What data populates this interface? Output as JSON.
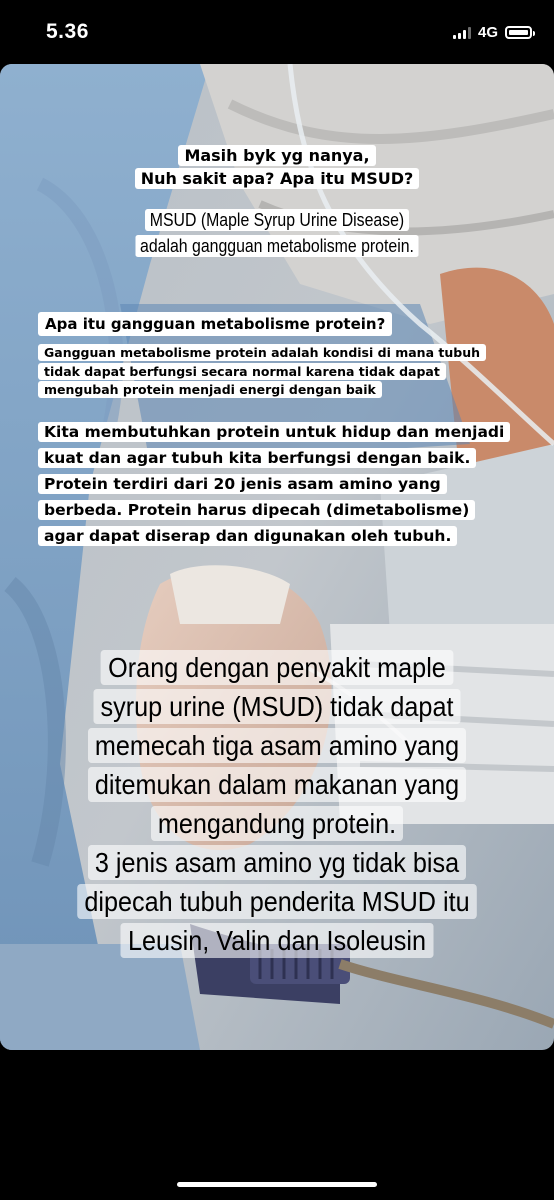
{
  "status_bar": {
    "time": "5.36",
    "network": "4G",
    "battery_icon": "battery-full-icon",
    "signal_icon": "cellular-signal-icon"
  },
  "story": {
    "background_image": "hospital-bed-blanket-iv-line-photo",
    "captions": {
      "question_intro": "Masih byk yg nanya,\nNuh sakit apa? Apa itu MSUD?",
      "msud_definition": "MSUD (Maple Syrup Urine Disease)\nadalah gangguan metabolisme protein.",
      "metabolism_question": "Apa itu gangguan metabolisme protein?",
      "metabolism_answer": "Gangguan metabolisme protein adalah kondisi di mana tubuh tidak dapat berfungsi secara normal karena tidak dapat mengubah protein menjadi energi dengan baik",
      "protein_explanation": "Kita membutuhkan protein untuk hidup dan menjadi kuat dan agar tubuh kita berfungsi dengan baik. Protein terdiri dari 20 jenis asam amino yang berbeda. Protein harus dipecah (dimetabolisme) agar dapat diserap dan digunakan oleh tubuh.",
      "amino_acids": "Orang dengan penyakit maple\nsyrup urine (MSUD) tidak dapat\nmemecah tiga asam amino yang\nditemukan dalam makanan yang\nmengandung protein.\n3 jenis asam amino yg tidak bisa\ndipecah tubuh penderita MSUD itu\nLeusin, Valin dan Isoleusin"
    }
  },
  "colors": {
    "caption_background": "#ffffff",
    "caption_text": "#000000",
    "screen_background": "#000000"
  }
}
